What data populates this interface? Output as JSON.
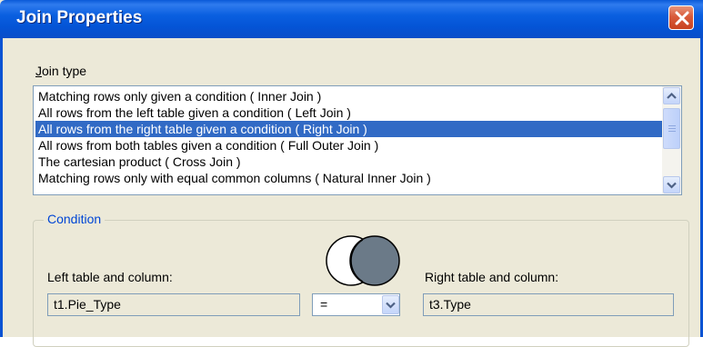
{
  "window": {
    "title": "Join Properties"
  },
  "join_type": {
    "label_mnemonic": "J",
    "label_rest": "oin type",
    "options": [
      "Matching rows only given a condition ( Inner Join )",
      "All rows from the left table given a condition ( Left Join )",
      "All rows from the right table given a condition ( Right Join )",
      "All rows from both tables given a condition ( Full Outer Join )",
      "The cartesian product ( Cross Join )",
      "Matching rows only with equal common columns ( Natural Inner Join )"
    ],
    "selected_index": 2
  },
  "condition": {
    "group_title": "Condition",
    "left_label": "Left table and column:",
    "left_value": "t1.Pie_Type",
    "operator": "=",
    "right_label": "Right table and column:",
    "right_value": "t3.Type"
  },
  "icons": {
    "close": "close-icon",
    "scroll_up": "chevron-up-icon",
    "scroll_down": "chevron-down-icon",
    "dropdown": "chevron-down-icon",
    "venn": "venn-diagram-right-join-icon"
  },
  "colors": {
    "titlebar": "#0a5ad8",
    "selection": "#316ac5",
    "group_title": "#0046d5",
    "close_button": "#d95b3b"
  }
}
